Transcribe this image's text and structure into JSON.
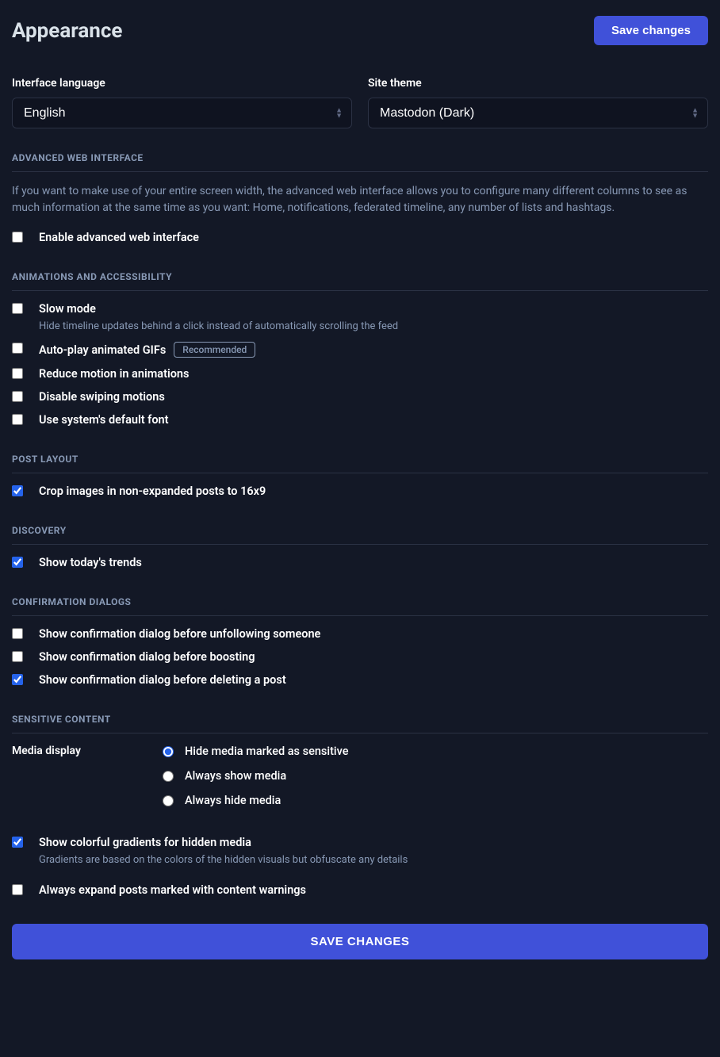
{
  "page": {
    "title": "Appearance",
    "save_btn": "Save changes",
    "save_btn_full": "SAVE CHANGES"
  },
  "fields": {
    "language": {
      "label": "Interface language",
      "value": "English"
    },
    "theme": {
      "label": "Site theme",
      "value": "Mastodon (Dark)"
    }
  },
  "sections": {
    "advanced": {
      "title": "ADVANCED WEB INTERFACE",
      "desc": "If you want to make use of your entire screen width, the advanced web interface allows you to configure many different columns to see as much information at the same time as you want: Home, notifications, federated timeline, any number of lists and hashtags.",
      "enable_label": "Enable advanced web interface"
    },
    "animations": {
      "title": "ANIMATIONS AND ACCESSIBILITY",
      "slow_mode": {
        "label": "Slow mode",
        "hint": "Hide timeline updates behind a click instead of automatically scrolling the feed"
      },
      "auto_play": {
        "label": "Auto-play animated GIFs",
        "badge": "Recommended"
      },
      "reduce_motion": {
        "label": "Reduce motion in animations"
      },
      "disable_swipe": {
        "label": "Disable swiping motions"
      },
      "system_font": {
        "label": "Use system's default font"
      }
    },
    "post_layout": {
      "title": "POST LAYOUT",
      "crop": {
        "label": "Crop images in non-expanded posts to 16x9"
      }
    },
    "discovery": {
      "title": "DISCOVERY",
      "trends": {
        "label": "Show today's trends"
      }
    },
    "confirmation": {
      "title": "CONFIRMATION DIALOGS",
      "unfollow": {
        "label": "Show confirmation dialog before unfollowing someone"
      },
      "boost": {
        "label": "Show confirmation dialog before boosting"
      },
      "delete": {
        "label": "Show confirmation dialog before deleting a post"
      }
    },
    "sensitive": {
      "title": "SENSITIVE CONTENT",
      "media_display": {
        "label": "Media display",
        "hide": "Hide media marked as sensitive",
        "show": "Always show media",
        "hide_all": "Always hide media"
      },
      "gradients": {
        "label": "Show colorful gradients for hidden media",
        "hint": "Gradients are based on the colors of the hidden visuals but obfuscate any details"
      },
      "expand_cw": {
        "label": "Always expand posts marked with content warnings"
      }
    }
  }
}
